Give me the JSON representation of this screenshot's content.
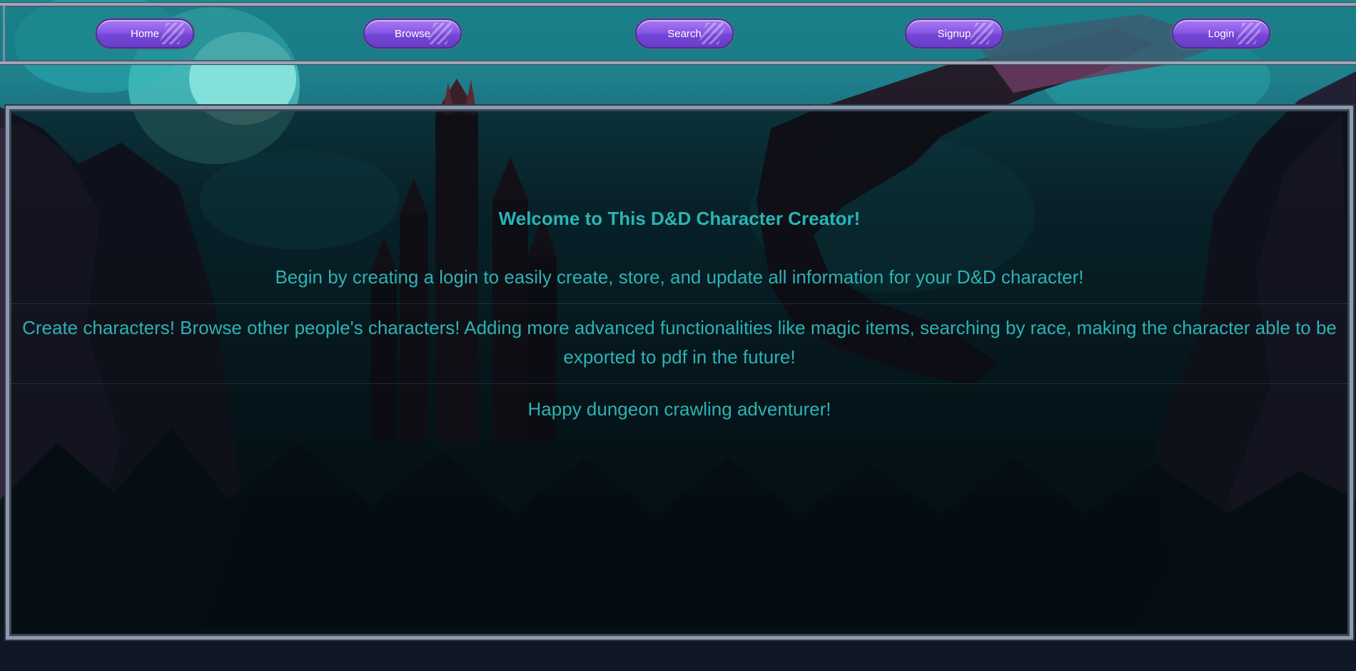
{
  "nav": {
    "items": [
      {
        "label": "Home"
      },
      {
        "label": "Browse"
      },
      {
        "label": "Search"
      },
      {
        "label": "Signup"
      },
      {
        "label": "Login"
      }
    ]
  },
  "main": {
    "title": "Welcome to This D&D Character Creator!",
    "intro": "Begin by creating a login to easily create, store, and update all information for your D&D character!",
    "features": "Create characters! Browse other people's characters! Adding more advanced functionalities like magic items, searching by race, making the character able to be exported to pdf in the future!",
    "closing": "Happy dungeon crawling adventurer!"
  },
  "colors": {
    "accent_text": "#2bb3b3",
    "button_purple": "#8a57e6",
    "frame_silver": "#8d9aae"
  }
}
